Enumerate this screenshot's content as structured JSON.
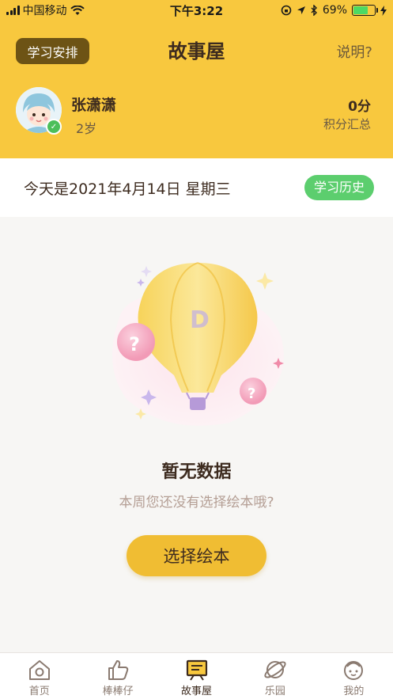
{
  "status_bar": {
    "carrier": "中国移动",
    "time": "下午3:22",
    "battery_percent": "69%",
    "battery_level": 0.69,
    "icons": [
      "signal-icon",
      "wifi-icon",
      "screen-lock-icon",
      "location-icon",
      "bluetooth-icon",
      "battery-icon",
      "charging-icon"
    ]
  },
  "header": {
    "schedule_label": "学习安排",
    "title": "故事屋",
    "help_label": "说明?",
    "bg_color": "#f8c83e"
  },
  "profile": {
    "name": "张潇潇",
    "age": "2岁",
    "points": "0分",
    "points_label": "积分汇总"
  },
  "date_bar": {
    "date_text": "今天是2021年4月14日 星期三",
    "history_label": "学习历史",
    "history_color": "#5cce6e"
  },
  "empty_state": {
    "title": "暂无数据",
    "subtitle": "本周您还没有选择绘本哦?",
    "button_label": "选择绘本",
    "button_color": "#f0bd33"
  },
  "tabbar": {
    "tabs": [
      {
        "label": "首页",
        "icon": "home-icon",
        "active": false
      },
      {
        "label": "棒棒仔",
        "icon": "thumbs-up-icon",
        "active": false
      },
      {
        "label": "故事屋",
        "icon": "story-board-icon",
        "active": true
      },
      {
        "label": "乐园",
        "icon": "planet-icon",
        "active": false
      },
      {
        "label": "我的",
        "icon": "kid-face-icon",
        "active": false
      }
    ]
  }
}
